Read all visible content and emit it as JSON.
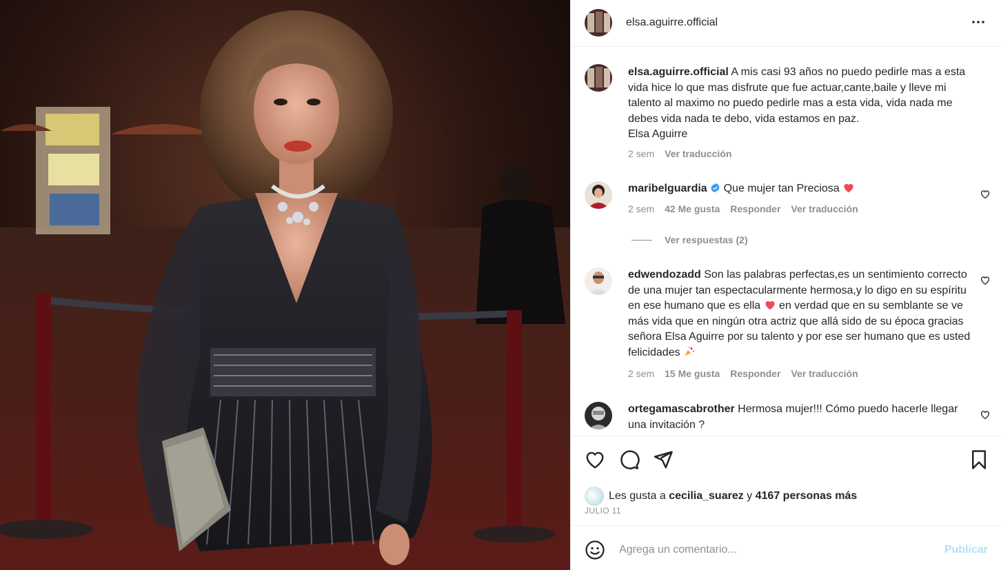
{
  "post": {
    "username": "elsa.aguirre.official",
    "more_icon": "more-horizontal-icon"
  },
  "caption": {
    "username": "elsa.aguirre.official",
    "text": "A mis casi 93 años no puedo pedirle mas a esta vida hice lo que mas disfrute que fue actuar,cante,baile y lleve mi talento al maximo no puedo pedirle mas a esta vida, vida nada me debes vida nada te debo, vida estamos en paz.",
    "signature": "Elsa Aguirre",
    "time": "2 sem",
    "translate": "Ver traducción"
  },
  "comments": [
    {
      "username": "maribelguardia",
      "verified": true,
      "text": "Que mujer tan Preciosa",
      "emoji": "heart-emoji",
      "time": "2 sem",
      "likes": "42 Me gusta",
      "reply": "Responder",
      "translate": "Ver traducción",
      "replies": "Ver respuestas (2)"
    },
    {
      "username": "edwendozadd",
      "text_1": "Son las palabras perfectas,es un sentimiento correcto de una mujer tan espectacularmente hermosa,y lo digo en su espíritu en ese humano que es ella",
      "text_2": "en verdad que en su semblante se ve más vida que en ningún otra actriz que allá sido de su época gracias señora Elsa Aguirre por su talento y por ese ser humano que es usted felicidades",
      "time": "2 sem",
      "likes": "15 Me gusta",
      "reply": "Responder",
      "translate": "Ver traducción"
    },
    {
      "username": "ortegamascabrother",
      "text": "Hermosa mujer!!! Cómo puedo hacerle llegar una invitación ?"
    }
  ],
  "likes": {
    "prefix": "Les gusta a",
    "user": "cecilia_suarez",
    "joiner": "y",
    "count_text": "4167 personas más"
  },
  "date": "JULIO 11",
  "add_comment": {
    "placeholder": "Agrega un comentario...",
    "publish": "Publicar"
  },
  "colors": {
    "heart_red": "#ed4956",
    "verified_blue": "#3897f0",
    "publish_disabled": "#b2dffc",
    "muted": "#8e8e8e"
  }
}
